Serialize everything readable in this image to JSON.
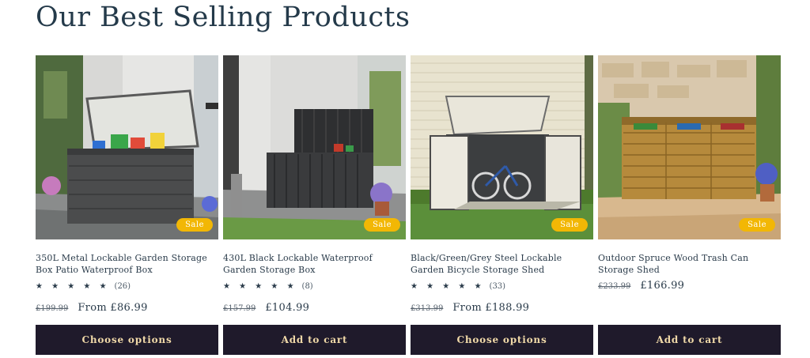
{
  "section": {
    "title": "Our Best Selling Products"
  },
  "products": [
    {
      "title": "350L Metal Lockable Garden Storage Box Patio Waterproof Box",
      "badge": "Sale",
      "stars": "★ ★ ★ ★ ★",
      "rating_value": 4.5,
      "review_count": "(26)",
      "was_price": "£199.99",
      "price": "From £86.99",
      "button": "Choose options"
    },
    {
      "title": "430L Black Lockable Waterproof Garden Storage Box",
      "badge": "Sale",
      "stars": "★ ★ ★ ★ ★",
      "rating_value": 5,
      "review_count": "(8)",
      "was_price": "£157.99",
      "price": "£104.99",
      "button": "Add to cart"
    },
    {
      "title": "Black/Green/Grey Steel Lockable Garden Bicycle Storage Shed",
      "badge": "Sale",
      "stars": "★ ★ ★ ★ ★",
      "rating_value": 4.5,
      "review_count": "(33)",
      "was_price": "£313.99",
      "price": "From £188.99",
      "button": "Choose options"
    },
    {
      "title": "Outdoor Spruce Wood Trash Can Storage Shed",
      "badge": "Sale",
      "was_price": "£233.99",
      "price": "£166.99",
      "button": "Add to cart"
    }
  ],
  "colors": {
    "button_bg": "#1f1a2b",
    "button_text": "#f0d9a8",
    "sale_badge": "#f2b705"
  }
}
